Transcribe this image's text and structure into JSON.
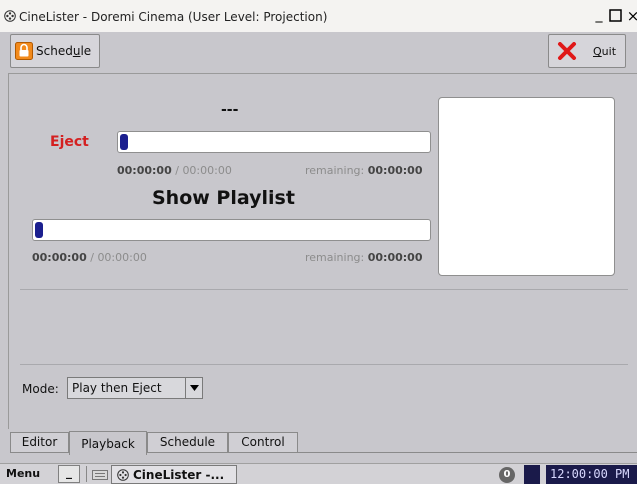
{
  "window": {
    "title": "CineLister - Doremi Cinema (User Level: Projection)",
    "app_icon": "film-reel-icon",
    "minimize_label": "_",
    "maximize_label": "□",
    "close_label": "×"
  },
  "toolbar": {
    "schedule_label": "Schedule",
    "schedule_icon": "lock-icon",
    "quit_label": "Quit",
    "quit_icon": "red-x-icon"
  },
  "playback": {
    "clip_title": "---",
    "eject_label": "Eject",
    "clip_elapsed": "00:00:00",
    "clip_separator": " / ",
    "clip_total": "00:00:00",
    "clip_remaining_label": "remaining: ",
    "clip_remaining": "00:00:00",
    "clip_progress": 0,
    "playlist_title": "Show Playlist",
    "playlist_elapsed": "00:00:00",
    "playlist_separator": " / ",
    "playlist_total": "00:00:00",
    "playlist_remaining_label": "remaining: ",
    "playlist_remaining": "00:00:00",
    "playlist_progress": 0
  },
  "mode": {
    "label": "Mode:",
    "selected": "Play then Eject"
  },
  "tabs": [
    {
      "label": "Editor"
    },
    {
      "label": "Playback"
    },
    {
      "label": "Schedule"
    },
    {
      "label": "Control"
    }
  ],
  "taskbar": {
    "menu_label": "Menu",
    "underscore_label": "_",
    "task_label": "CineLister -...",
    "counter": "0",
    "clock": "12:00:00 PM"
  },
  "colors": {
    "eject_red": "#d42020",
    "progress_blue": "#1b1f8f",
    "clock_bg": "#1a1a4a"
  }
}
